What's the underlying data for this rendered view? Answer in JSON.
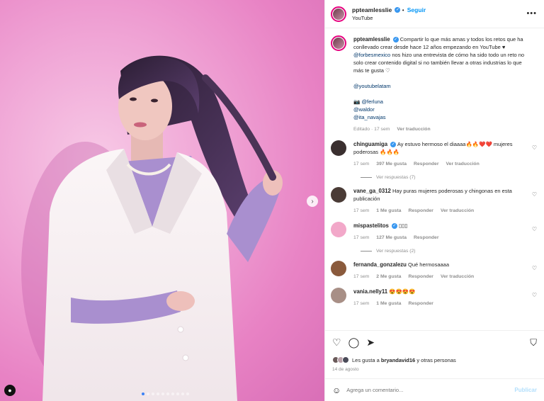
{
  "post": {
    "dots_count": 10,
    "active_dot": 0
  },
  "header": {
    "username": "ppteamlesslie",
    "follow_label": "Seguir",
    "separator": "•",
    "subtitle": "YouTube",
    "more_label": "•••"
  },
  "caption": {
    "username": "ppteamlesslie",
    "text_1": "Compartir lo que más amas y todos los retos que ha conllevado crear desde hace 12 años empezando en YouTube ♥",
    "mention_forbes": "@forbesmexico",
    "text_2": "nos hizo una entrevista de cómo ha sido todo un reto no solo crear contenido digital si no también llevar a otras industrias lo que más te gusta ♡",
    "mention_youtube": "@youtubelatam",
    "camera": "📷",
    "mention_ferluna": "@ferluna",
    "mention_waldor": "@waldor",
    "mention_ita": "@ita_navajas",
    "meta": "Editado · 17 sem",
    "translate": "Ver traducción"
  },
  "comments": [
    {
      "username": "chinguamiga",
      "verified": true,
      "text": "Ay estuvo hermoso el diaaaa🔥🔥❤️❤️ mujeres poderosas 🔥🔥🔥",
      "time": "17 sem",
      "likes": "397 Me gusta",
      "reply": "Responder",
      "translate": "Ver traducción",
      "replies": "Ver respuestas (7)",
      "color": "#3a2f2f"
    },
    {
      "username": "vane_ga_0312",
      "verified": false,
      "text": "Hay puras mujeres poderosas y chingonas en esta publicación",
      "time": "17 sem",
      "likes": "1 Me gusta",
      "reply": "Responder",
      "translate": "Ver traducción",
      "replies": "",
      "color": "#4a3b36"
    },
    {
      "username": "mispastelitos",
      "verified": true,
      "text": "▯▯▯",
      "time": "17 sem",
      "likes": "127 Me gusta",
      "reply": "Responder",
      "translate": "",
      "replies": "Ver respuestas (2)",
      "color": "#f2a8c9"
    },
    {
      "username": "fernanda_gonzalezu",
      "verified": false,
      "text": "Qué hermosaaaa",
      "time": "17 sem",
      "likes": "2 Me gusta",
      "reply": "Responder",
      "translate": "Ver traducción",
      "replies": "",
      "color": "#8a5a3c"
    },
    {
      "username": "vania.nelly11",
      "verified": false,
      "text": "😍😍😍😍",
      "time": "17 sem",
      "likes": "1 Me gusta",
      "reply": "Responder",
      "translate": "",
      "replies": "",
      "color": "#a88f86"
    }
  ],
  "likes": {
    "prefix": "Les gusta a",
    "user": "bryandavid16",
    "suffix": "y otras personas"
  },
  "date": "14 de agosto",
  "add_comment": {
    "placeholder": "Agrega un comentario...",
    "post_label": "Publicar"
  },
  "colors": {
    "accent": "#0095f6",
    "verified": "#3897f0",
    "muted": "#8e8e8e"
  }
}
